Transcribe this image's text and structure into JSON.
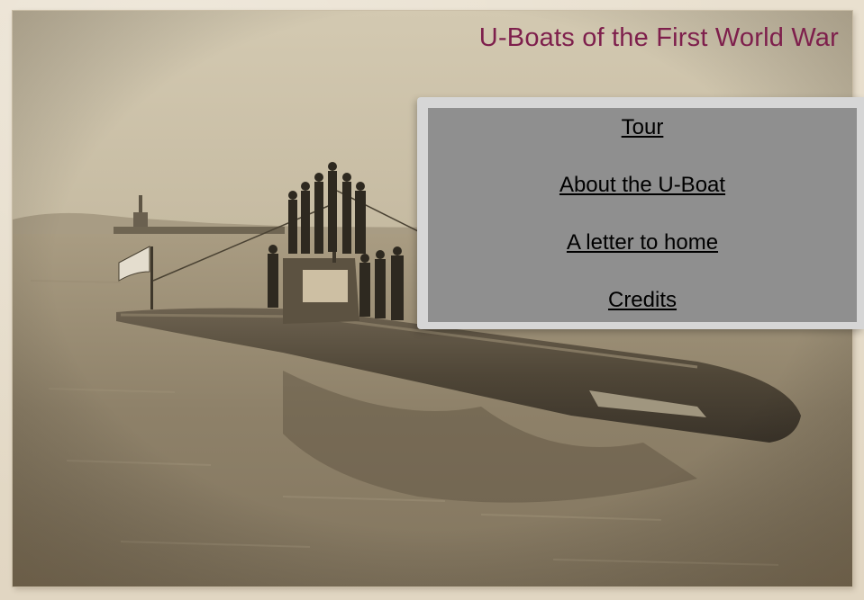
{
  "header": {
    "title": "U-Boats of the First World War"
  },
  "nav": {
    "items": [
      {
        "label": "Tour"
      },
      {
        "label": "About the U-Boat"
      },
      {
        "label": "A letter to home"
      },
      {
        "label": "Credits"
      }
    ]
  },
  "colors": {
    "title": "#7e1f4c",
    "panel_outer": "#d6d6d6",
    "panel_inner": "#8f8f8f",
    "link": "#000000"
  }
}
